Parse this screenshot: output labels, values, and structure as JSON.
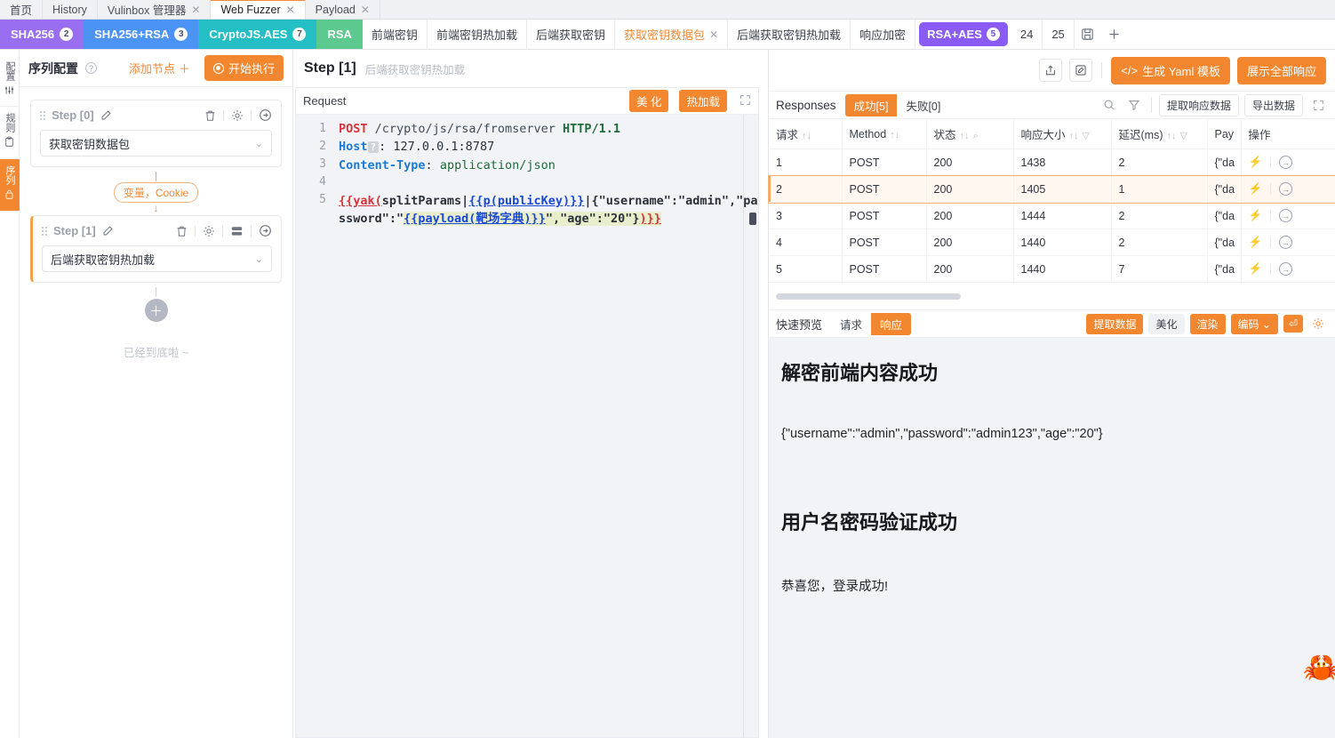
{
  "window_tabs": [
    {
      "label": "首页",
      "closable": false,
      "active": false
    },
    {
      "label": "History",
      "closable": false,
      "active": false
    },
    {
      "label": "Vulinbox 管理器",
      "closable": true,
      "active": false
    },
    {
      "label": "Web Fuzzer",
      "closable": true,
      "active": true
    },
    {
      "label": "Payload",
      "closable": true,
      "active": false
    }
  ],
  "group_tabs": [
    {
      "label": "SHA256",
      "count": "2",
      "color": "#9a6ef0"
    },
    {
      "label": "SHA256+RSA",
      "count": "3",
      "color": "#4b94f5"
    },
    {
      "label": "CryptoJS.AES",
      "count": "7",
      "color": "#23bfc4"
    },
    {
      "label": "RSA",
      "count": "",
      "color": "#5cc98e"
    }
  ],
  "fuzzer_tabs": [
    {
      "label": "前端密钥",
      "active": false,
      "closable": false
    },
    {
      "label": "前端密钥热加载",
      "active": false,
      "closable": false
    },
    {
      "label": "后端获取密钥",
      "active": false,
      "closable": false
    },
    {
      "label": "获取密钥数据包",
      "active": true,
      "closable": true
    },
    {
      "label": "后端获取密钥热加载",
      "active": false,
      "closable": false
    },
    {
      "label": "响应加密",
      "active": false,
      "closable": false
    }
  ],
  "fuzzer_group_selected": {
    "label": "RSA+AES",
    "count": "5"
  },
  "fuzzer_numeric_tabs": [
    "24",
    "25"
  ],
  "tabbar_icons": {
    "save": "save-icon",
    "add": "plus-icon"
  },
  "rail": [
    {
      "label": "配置",
      "icon": "sliders-icon",
      "active": false
    },
    {
      "label": "规则",
      "icon": "clipboard-icon",
      "active": false
    },
    {
      "label": "序列",
      "icon": "lock-icon",
      "active": true
    }
  ],
  "sequence": {
    "title": "序列配置",
    "help_icon": "question-circle-icon",
    "add_node_label": "添加节点",
    "run_label": "开始执行",
    "end_text": "已经到底啦 ~",
    "connector_label": "变量，Cookie",
    "steps": [
      {
        "name": "Step [0]",
        "value": "获取密钥数据包",
        "active": false,
        "icons": [
          "edit-icon",
          "trash-icon",
          "gear-icon",
          "arrow-right-circle-icon"
        ]
      },
      {
        "name": "Step [1]",
        "value": "后端获取密钥热加载",
        "active": true,
        "icons": [
          "edit-icon",
          "trash-icon",
          "gear-icon",
          "database-icon",
          "arrow-right-circle-icon"
        ]
      }
    ]
  },
  "center": {
    "step_title": "Step [1]",
    "step_subtitle": "后端获取密钥热加载",
    "request_label": "Request",
    "beautify_label": "美 化",
    "hotload_label": "热加载",
    "expand_icon": "expand-icon",
    "code_lines": [
      "1",
      "2",
      "3",
      "4",
      "5"
    ],
    "request": {
      "method": "POST",
      "path": "/crypto/js/rsa/fromserver",
      "proto": "HTTP/1.1",
      "host_key": "Host",
      "host_hint": "?",
      "host_value": "127.0.0.1:8787",
      "content_type_key": "Content-Type",
      "content_type_value": "application/json",
      "body_p1": "{{yak(",
      "body_p2": "splitParams|",
      "body_p3": "{{p(publicKey)}}",
      "body_p4": "|",
      "body_p5": "{\"username\":\"admin\",\"password\":\"",
      "body_p6": "{{payload(靶场字典)}}",
      "body_p7": "\",\"age\":\"20\"}",
      "body_p8": ")}}"
    }
  },
  "toolbar": {
    "share_icon": "share-icon",
    "edit_icon": "edit-square-icon",
    "yaml_label": "生成 Yaml 模板",
    "yaml_icon": "code-icon",
    "show_all_label": "展示全部响应"
  },
  "responses": {
    "title": "Responses",
    "success_tab": "成功[5]",
    "fail_tab": "失败[0]",
    "search_icon": "search-icon",
    "filter_icon": "filter-icon",
    "extract_label": "提取响应数据",
    "export_label": "导出数据",
    "expand_icon": "expand-icon",
    "columns": [
      "请求",
      "Method",
      "状态",
      "响应大小",
      "延迟(ms)",
      "Pay",
      "操作"
    ],
    "rows": [
      {
        "req": "1",
        "method": "POST",
        "status": "200",
        "size": "1438",
        "latency": "2",
        "payload": "{\"da",
        "selected": false
      },
      {
        "req": "2",
        "method": "POST",
        "status": "200",
        "size": "1405",
        "latency": "1",
        "payload": "{\"da",
        "selected": true
      },
      {
        "req": "3",
        "method": "POST",
        "status": "200",
        "size": "1444",
        "latency": "2",
        "payload": "{\"da",
        "selected": false
      },
      {
        "req": "4",
        "method": "POST",
        "status": "200",
        "size": "1440",
        "latency": "2",
        "payload": "{\"da",
        "selected": false
      },
      {
        "req": "5",
        "method": "POST",
        "status": "200",
        "size": "1440",
        "latency": "7",
        "payload": "{\"da",
        "selected": false
      }
    ]
  },
  "preview": {
    "label": "快速预览",
    "tab_request": "请求",
    "tab_response": "响应",
    "extract_label": "提取数据",
    "beautify_label": "美化",
    "render_label": "渲染",
    "encode_label": "编码",
    "wrap_icon": "wrap-icon",
    "gear_icon": "gear-icon",
    "body": {
      "heading1": "解密前端内容成功",
      "text1": "{\"username\":\"admin\",\"password\":\"admin123\",\"age\":\"20\"}",
      "heading2": "用户名密码验证成功",
      "text2": "恭喜您，登录成功!",
      "mascot": "crab-mascot"
    }
  }
}
